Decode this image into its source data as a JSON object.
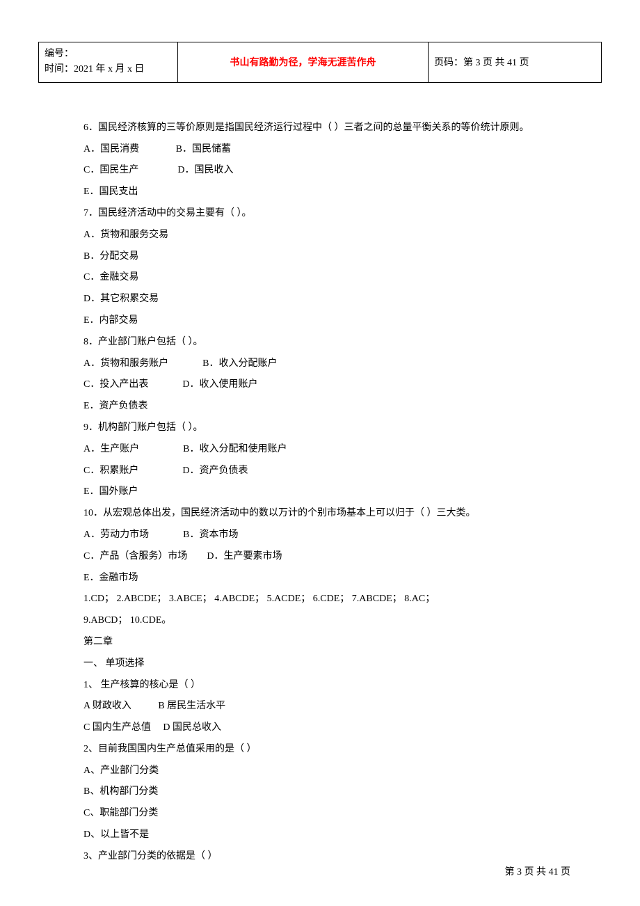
{
  "header": {
    "left_line1": "编号：",
    "left_line2": "时间：2021 年 x 月 x 日",
    "center": "书山有路勤为径，学海无涯苦作舟",
    "right": "页码：第 3 页  共 41 页"
  },
  "content": {
    "q6_stem": "6．国民经济核算的三等价原则是指国民经济运行过程中（    ）三者之间的总量平衡关系的等价统计原则。",
    "q6_a": "A．国民消费",
    "q6_b": "B．国民储蓄",
    "q6_c": "C．国民生产",
    "q6_d": "D．国民收入",
    "q6_e": "E．国民支出",
    "q7_stem": "7．国民经济活动中的交易主要有（    ）。",
    "q7_a": "A．货物和服务交易",
    "q7_b": "B．分配交易",
    "q7_c": "C．金融交易",
    "q7_d": "D．其它积累交易",
    "q7_e": "E．内部交易",
    "q8_stem": "8．产业部门账户包括（     ）。",
    "q8_a": "A．货物和服务账户",
    "q8_b": "B．收入分配账户",
    "q8_c": "C．投入产出表",
    "q8_d": "D．收入使用账户",
    "q8_e": "E．资产负债表",
    "q9_stem": "9．机构部门账户包括（    ）。",
    "q9_a": "A．生产账户",
    "q9_b": "B．收入分配和使用账户",
    "q9_c": "C．积累账户",
    "q9_d": "D．资产负债表",
    "q9_e": "E．国外账户",
    "q10_stem": "10．从宏观总体出发，国民经济活动中的数以万计的个别市场基本上可以归于（     ）三大类。",
    "q10_a": "A．劳动力市场",
    "q10_b": "B．资本市场",
    "q10_c": "C．产品（含服务）市场",
    "q10_d": "D．生产要素市场",
    "q10_e": "E．金融市场",
    "answers_line1": "1.CD；   2.ABCDE；    3.ABCE；   4.ABCDE；   5.ACDE；   6.CDE；  7.ABCDE；  8.AC；",
    "answers_line2": "9.ABCD；    10.CDE。",
    "chapter2": "第二章",
    "section1": " 一、 单项选择",
    "c2q1_stem": "1、 生产核算的核心是（  ）",
    "c2q1_a": "A 财政收入",
    "c2q1_b": "B 居民生活水平",
    "c2q1_c": "C 国内生产总值",
    "c2q1_d": "D 国民总收入",
    "c2q2_stem": "2、目前我国国内生产总值采用的是（  ）",
    "c2q2_a": "A、产业部门分类",
    "c2q2_b": "B、机构部门分类",
    "c2q2_c": "C、职能部门分类",
    "c2q2_d": "D、以上皆不是",
    "c2q3_stem": "3、产业部门分类的依据是（  ）"
  },
  "footer": "第  3  页  共  41  页"
}
